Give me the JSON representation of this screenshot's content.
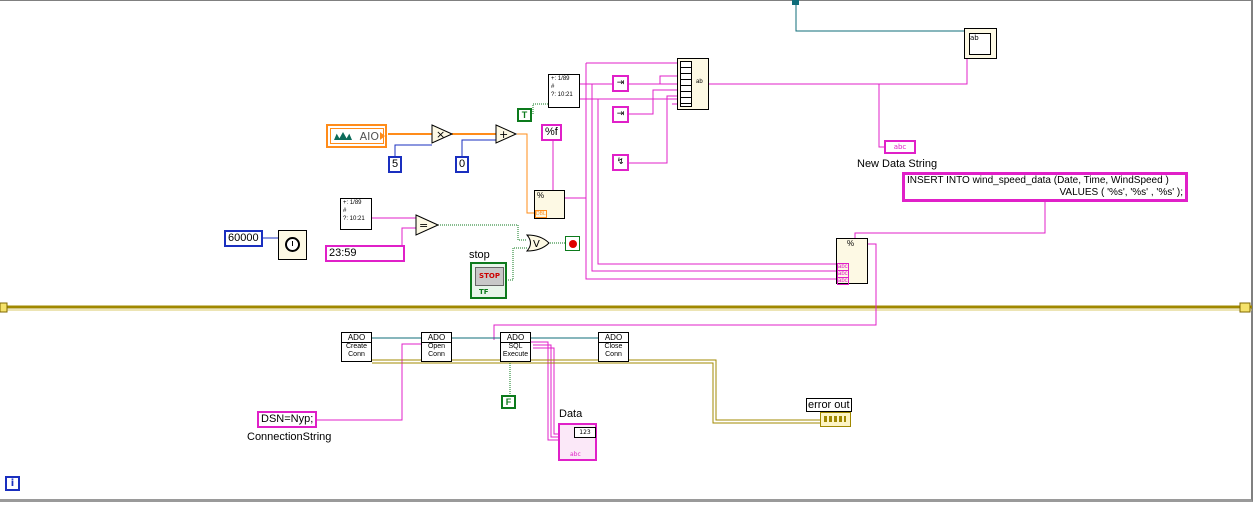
{
  "constants": {
    "aio_label": "AIO",
    "multiplier": "5",
    "offset": "0",
    "bool_true": "T",
    "bool_false": "F",
    "format_float": "%f",
    "wait_ms": "60000",
    "time_compare": "23:59",
    "dsn": "DSN=Nyp;",
    "sql_line1": "INSERT INTO wind_speed_data (Date, Time, WindSpeed )",
    "sql_line2": "VALUES ( '%s', '%s' , '%s' );"
  },
  "labels": {
    "new_data_string": "New Data String",
    "stop": "stop",
    "connection_string": "ConnectionString",
    "data": "Data",
    "error_out": "error out",
    "iteration": "i"
  },
  "ado": {
    "create": {
      "head": "ADO",
      "line1": "Create",
      "line2": "Conn"
    },
    "open": {
      "head": "ADO",
      "line1": "Open",
      "line2": "Conn"
    },
    "execute": {
      "head": "ADO",
      "line1": "SQL",
      "line2": "Execute"
    },
    "close": {
      "head": "ADO",
      "line1": "Close",
      "line2": "Conn"
    }
  },
  "glyphs": {
    "multiply": "×",
    "add": "+",
    "equal": "=",
    "or": "V",
    "stop_button": "STOP",
    "tf": "TF",
    "fmt_pct": "%",
    "dbl": "DBL",
    "abc": "abc",
    "num123": "123",
    "date": "1/89",
    "time": "10:21"
  },
  "colors": {
    "string_wire": "#e020c8",
    "numeric_wire": "#1a2fbf",
    "dbl_wire": "#ff8c1a",
    "bool_wire": "#0c7a1c",
    "error_wire": "#a08800",
    "ref_wire": "#0f6d7a",
    "frame": "#a08800"
  },
  "icons": [
    "wait-clock-icon",
    "aio-device-icon",
    "stop-circle-icon",
    "string-concat-icon",
    "error-cluster-icon",
    "array-indicator-icon",
    "file-write-icon"
  ]
}
